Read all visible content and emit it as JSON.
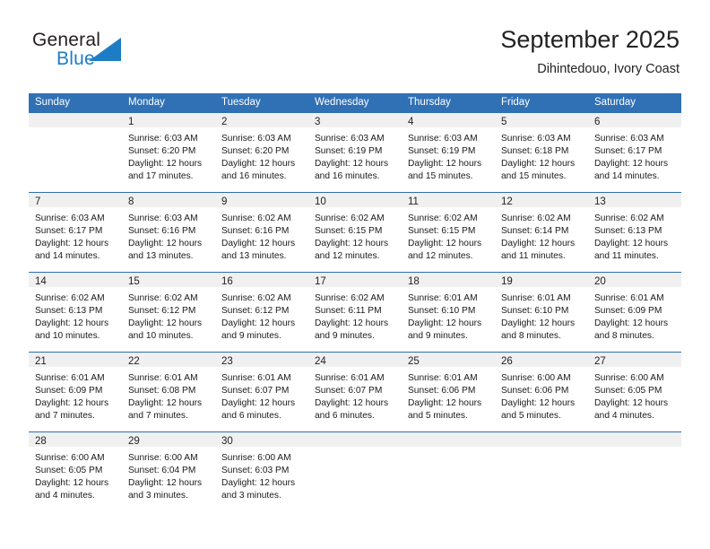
{
  "brand": {
    "name_top": "General",
    "name_bottom": "Blue",
    "triangle_color": "#1d7cc4",
    "text_color": "#231f20"
  },
  "header": {
    "title": "September 2025",
    "subtitle": "Dihintedouo, Ivory Coast"
  },
  "theme": {
    "header_blue": "#3071b5",
    "row_rule_blue": "#2f6fb0",
    "day_band_gray": "#f0f0f0"
  },
  "weekday_headers": [
    "Sunday",
    "Monday",
    "Tuesday",
    "Wednesday",
    "Thursday",
    "Friday",
    "Saturday"
  ],
  "weeks": [
    [
      {
        "day": "",
        "lines": []
      },
      {
        "day": "1",
        "lines": [
          "Sunrise: 6:03 AM",
          "Sunset: 6:20 PM",
          "Daylight: 12 hours",
          "and 17 minutes."
        ]
      },
      {
        "day": "2",
        "lines": [
          "Sunrise: 6:03 AM",
          "Sunset: 6:20 PM",
          "Daylight: 12 hours",
          "and 16 minutes."
        ]
      },
      {
        "day": "3",
        "lines": [
          "Sunrise: 6:03 AM",
          "Sunset: 6:19 PM",
          "Daylight: 12 hours",
          "and 16 minutes."
        ]
      },
      {
        "day": "4",
        "lines": [
          "Sunrise: 6:03 AM",
          "Sunset: 6:19 PM",
          "Daylight: 12 hours",
          "and 15 minutes."
        ]
      },
      {
        "day": "5",
        "lines": [
          "Sunrise: 6:03 AM",
          "Sunset: 6:18 PM",
          "Daylight: 12 hours",
          "and 15 minutes."
        ]
      },
      {
        "day": "6",
        "lines": [
          "Sunrise: 6:03 AM",
          "Sunset: 6:17 PM",
          "Daylight: 12 hours",
          "and 14 minutes."
        ]
      }
    ],
    [
      {
        "day": "7",
        "lines": [
          "Sunrise: 6:03 AM",
          "Sunset: 6:17 PM",
          "Daylight: 12 hours",
          "and 14 minutes."
        ]
      },
      {
        "day": "8",
        "lines": [
          "Sunrise: 6:03 AM",
          "Sunset: 6:16 PM",
          "Daylight: 12 hours",
          "and 13 minutes."
        ]
      },
      {
        "day": "9",
        "lines": [
          "Sunrise: 6:02 AM",
          "Sunset: 6:16 PM",
          "Daylight: 12 hours",
          "and 13 minutes."
        ]
      },
      {
        "day": "10",
        "lines": [
          "Sunrise: 6:02 AM",
          "Sunset: 6:15 PM",
          "Daylight: 12 hours",
          "and 12 minutes."
        ]
      },
      {
        "day": "11",
        "lines": [
          "Sunrise: 6:02 AM",
          "Sunset: 6:15 PM",
          "Daylight: 12 hours",
          "and 12 minutes."
        ]
      },
      {
        "day": "12",
        "lines": [
          "Sunrise: 6:02 AM",
          "Sunset: 6:14 PM",
          "Daylight: 12 hours",
          "and 11 minutes."
        ]
      },
      {
        "day": "13",
        "lines": [
          "Sunrise: 6:02 AM",
          "Sunset: 6:13 PM",
          "Daylight: 12 hours",
          "and 11 minutes."
        ]
      }
    ],
    [
      {
        "day": "14",
        "lines": [
          "Sunrise: 6:02 AM",
          "Sunset: 6:13 PM",
          "Daylight: 12 hours",
          "and 10 minutes."
        ]
      },
      {
        "day": "15",
        "lines": [
          "Sunrise: 6:02 AM",
          "Sunset: 6:12 PM",
          "Daylight: 12 hours",
          "and 10 minutes."
        ]
      },
      {
        "day": "16",
        "lines": [
          "Sunrise: 6:02 AM",
          "Sunset: 6:12 PM",
          "Daylight: 12 hours",
          "and 9 minutes."
        ]
      },
      {
        "day": "17",
        "lines": [
          "Sunrise: 6:02 AM",
          "Sunset: 6:11 PM",
          "Daylight: 12 hours",
          "and 9 minutes."
        ]
      },
      {
        "day": "18",
        "lines": [
          "Sunrise: 6:01 AM",
          "Sunset: 6:10 PM",
          "Daylight: 12 hours",
          "and 9 minutes."
        ]
      },
      {
        "day": "19",
        "lines": [
          "Sunrise: 6:01 AM",
          "Sunset: 6:10 PM",
          "Daylight: 12 hours",
          "and 8 minutes."
        ]
      },
      {
        "day": "20",
        "lines": [
          "Sunrise: 6:01 AM",
          "Sunset: 6:09 PM",
          "Daylight: 12 hours",
          "and 8 minutes."
        ]
      }
    ],
    [
      {
        "day": "21",
        "lines": [
          "Sunrise: 6:01 AM",
          "Sunset: 6:09 PM",
          "Daylight: 12 hours",
          "and 7 minutes."
        ]
      },
      {
        "day": "22",
        "lines": [
          "Sunrise: 6:01 AM",
          "Sunset: 6:08 PM",
          "Daylight: 12 hours",
          "and 7 minutes."
        ]
      },
      {
        "day": "23",
        "lines": [
          "Sunrise: 6:01 AM",
          "Sunset: 6:07 PM",
          "Daylight: 12 hours",
          "and 6 minutes."
        ]
      },
      {
        "day": "24",
        "lines": [
          "Sunrise: 6:01 AM",
          "Sunset: 6:07 PM",
          "Daylight: 12 hours",
          "and 6 minutes."
        ]
      },
      {
        "day": "25",
        "lines": [
          "Sunrise: 6:01 AM",
          "Sunset: 6:06 PM",
          "Daylight: 12 hours",
          "and 5 minutes."
        ]
      },
      {
        "day": "26",
        "lines": [
          "Sunrise: 6:00 AM",
          "Sunset: 6:06 PM",
          "Daylight: 12 hours",
          "and 5 minutes."
        ]
      },
      {
        "day": "27",
        "lines": [
          "Sunrise: 6:00 AM",
          "Sunset: 6:05 PM",
          "Daylight: 12 hours",
          "and 4 minutes."
        ]
      }
    ],
    [
      {
        "day": "28",
        "lines": [
          "Sunrise: 6:00 AM",
          "Sunset: 6:05 PM",
          "Daylight: 12 hours",
          "and 4 minutes."
        ]
      },
      {
        "day": "29",
        "lines": [
          "Sunrise: 6:00 AM",
          "Sunset: 6:04 PM",
          "Daylight: 12 hours",
          "and 3 minutes."
        ]
      },
      {
        "day": "30",
        "lines": [
          "Sunrise: 6:00 AM",
          "Sunset: 6:03 PM",
          "Daylight: 12 hours",
          "and 3 minutes."
        ]
      },
      {
        "day": "",
        "lines": []
      },
      {
        "day": "",
        "lines": []
      },
      {
        "day": "",
        "lines": []
      },
      {
        "day": "",
        "lines": []
      }
    ]
  ]
}
